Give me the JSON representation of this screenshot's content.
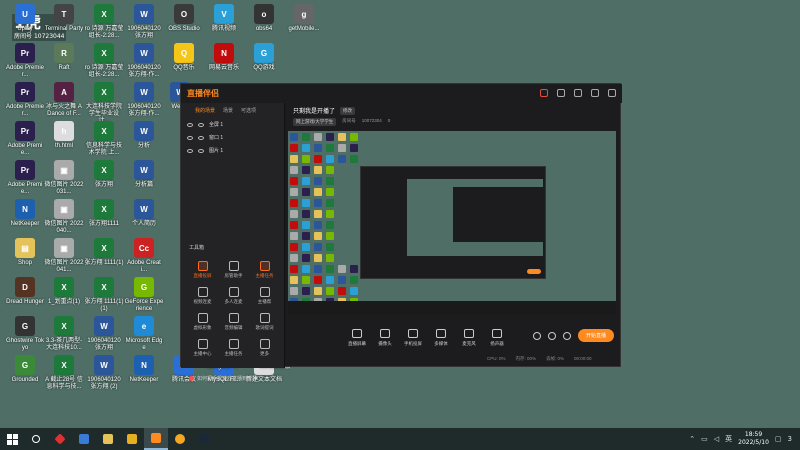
{
  "desktop": {
    "icons": [
      {
        "label": "Uplay",
        "color": "#2a6fd6",
        "glyph": "U"
      },
      {
        "label": "Terminal\n Party",
        "color": "#444",
        "glyph": "T"
      },
      {
        "label": "ro 诗源 万嘉莹组长-2:28...",
        "color": "#1d7a3a",
        "glyph": "X"
      },
      {
        "label": "1906040120 张方翔",
        "color": "#2b579a",
        "glyph": "W"
      },
      {
        "label": "OBS Studio",
        "color": "#3a3a3a",
        "glyph": "O"
      },
      {
        "label": "腾讯视频",
        "color": "#2aa0d6",
        "glyph": "V"
      },
      {
        "label": "obs64",
        "color": "#333",
        "glyph": "o"
      },
      {
        "label": "getMobile...",
        "color": "#666",
        "glyph": "g"
      },
      {
        "label": "Adobe Premier...",
        "color": "#2a1f4d",
        "glyph": "Pr"
      },
      {
        "label": "Raft",
        "color": "#5a7a5a",
        "glyph": "R"
      },
      {
        "label": "ro 诗源 万嘉莹组长-2:28...",
        "color": "#1d7a3a",
        "glyph": "X"
      },
      {
        "label": "1906040120 张方翔-作...",
        "color": "#2b579a",
        "glyph": "W"
      },
      {
        "label": "QQ音乐",
        "color": "#f5c518",
        "glyph": "Q"
      },
      {
        "label": "网易云音乐",
        "color": "#c20c0c",
        "glyph": "N"
      },
      {
        "label": "QQ游戏",
        "color": "#2aa0d6",
        "glyph": "G"
      },
      {
        "label": "Adobe Premier...",
        "color": "#2a1f4d",
        "glyph": "Pr"
      },
      {
        "label": "冰与火之舞 A Dance of F...",
        "color": "#552244",
        "glyph": "A"
      },
      {
        "label": "大连科技学院 学生毕业设计...",
        "color": "#1d7a3a",
        "glyph": "X"
      },
      {
        "label": "1906040120 张方翔-作...",
        "color": "#2b579a",
        "glyph": "W"
      },
      {
        "label": "Wec...",
        "color": "#2b579a",
        "glyph": "W"
      },
      {
        "label": "Adobe Premie...",
        "color": "#2a1f4d",
        "glyph": "Pr"
      },
      {
        "label": "th.html",
        "color": "#dddddd",
        "glyph": "h"
      },
      {
        "label": "信息科学与技术学院 上...",
        "color": "#1d7a3a",
        "glyph": "X"
      },
      {
        "label": "分析",
        "color": "#2b579a",
        "glyph": "W"
      },
      {
        "label": "Adobe Premie...",
        "color": "#2a1f4d",
        "glyph": "Pr"
      },
      {
        "label": "微信图片 2022031...",
        "color": "#aaaaaa",
        "glyph": "▣"
      },
      {
        "label": "张方翔",
        "color": "#1d7a3a",
        "glyph": "X"
      },
      {
        "label": "分析篇",
        "color": "#2b579a",
        "glyph": "W"
      },
      {
        "label": "NetKeeper",
        "color": "#1e60b0",
        "glyph": "N"
      },
      {
        "label": "微信图片 2022040...",
        "color": "#aaaaaa",
        "glyph": "▣"
      },
      {
        "label": "张方翔1111",
        "color": "#1d7a3a",
        "glyph": "X"
      },
      {
        "label": "个人简历",
        "color": "#2b579a",
        "glyph": "W"
      },
      {
        "label": "Shop",
        "color": "#e6c35a",
        "glyph": "▤"
      },
      {
        "label": "微信图片 2022041...",
        "color": "#aaaaaa",
        "glyph": "▣"
      },
      {
        "label": "张方翔 1111(1)",
        "color": "#1d7a3a",
        "glyph": "X"
      },
      {
        "label": "Adobe Creati...",
        "color": "#cc2222",
        "glyph": "Cc"
      },
      {
        "label": "Dread Hunger",
        "color": "#553322",
        "glyph": "D"
      },
      {
        "label": "1_划重点(1)",
        "color": "#1d7a3a",
        "glyph": "X"
      },
      {
        "label": "张方翔 1111(1)(1)",
        "color": "#1d7a3a",
        "glyph": "X"
      },
      {
        "label": "GeForce Experience",
        "color": "#76b900",
        "glyph": "G"
      },
      {
        "label": "Ghostwire Tokyo",
        "color": "#333333",
        "glyph": "G"
      },
      {
        "label": "3.3-茶几两型-大连科技10...",
        "color": "#1d7a3a",
        "glyph": "X"
      },
      {
        "label": "1906040120 张方翔",
        "color": "#2b579a",
        "glyph": "W"
      },
      {
        "label": "Microsoft Edge",
        "color": "#1f8ad6",
        "glyph": "e"
      },
      {
        "label": "Grounded",
        "color": "#3a8a3a",
        "glyph": "G"
      },
      {
        "label": "A 截止28号 信息科学与技...",
        "color": "#1d7a3a",
        "glyph": "X"
      },
      {
        "label": "1906040120 张方翔 (2)",
        "color": "#2b579a",
        "glyph": "W"
      },
      {
        "label": "NetKeeper",
        "color": "#1e60b0",
        "glyph": "N"
      },
      {
        "label": "腾讯会议",
        "color": "#2a6fd6",
        "glyph": "M"
      },
      {
        "label": "MySQL.Fr...",
        "color": "#2a6fd6",
        "glyph": "S"
      },
      {
        "label": "新建文本文档",
        "color": "#dddddd",
        "glyph": "T"
      }
    ],
    "extra_labels": [
      {
        "label": "Navigator ..."
      },
      {
        "label": "WeGame版"
      }
    ],
    "watermark": {
      "big": "1虎",
      "line1": "房间号",
      "line2": "10723044"
    }
  },
  "app": {
    "logo": "直播伴侣",
    "scene_tabs": [
      "我的场景",
      "场景",
      "可选项"
    ],
    "scenes": [
      "全屏 1",
      "窗口 1",
      "图片 1"
    ],
    "tools_title": "工具箱",
    "tools": [
      {
        "label": "直播投屏",
        "highlight": true
      },
      {
        "label": "房管助手",
        "highlight": false
      },
      {
        "label": "主播任务",
        "highlight": true
      },
      {
        "label": "视频连麦",
        "highlight": false
      },
      {
        "label": "多人连麦",
        "highlight": false
      },
      {
        "label": "主播帮",
        "highlight": false
      },
      {
        "label": "虚拟形象",
        "highlight": false
      },
      {
        "label": "音频编辑",
        "highlight": false
      },
      {
        "label": "歌词提词",
        "highlight": false
      },
      {
        "label": "主播中心",
        "highlight": false
      },
      {
        "label": "主播任务",
        "highlight": false
      },
      {
        "label": "更多",
        "highlight": false
      }
    ],
    "notice": "如何把手机游戏直播到虎牙...",
    "stream_title": "只剩我是开播了",
    "edit_label": "修改",
    "meta": {
      "category": "网上游戏/大学学生",
      "room_label": "房间号",
      "room_id": "10072304",
      "fans": "0"
    },
    "controls": [
      "直播屏幕",
      "摄像头",
      "手机投屏",
      "多媒体",
      "麦克风",
      "扬声器"
    ],
    "start_label": "开始直播",
    "status": [
      "CPU: 0%",
      "内存: 00%",
      "丢帧: 0%",
      "00:00:00"
    ]
  },
  "taskbar": {
    "time": "18:59",
    "date": "2022/5/10",
    "ime": "英",
    "notification_count": "3"
  }
}
